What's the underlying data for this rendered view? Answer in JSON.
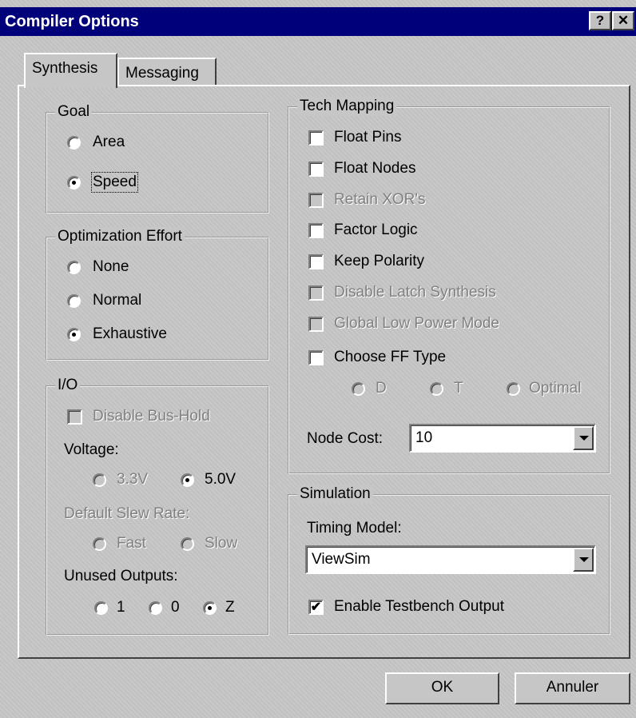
{
  "window": {
    "title": "Compiler Options",
    "help_label": "?",
    "close_label": "✕"
  },
  "tabs": [
    {
      "label": "Synthesis",
      "active": true
    },
    {
      "label": "Messaging",
      "active": false
    }
  ],
  "goal": {
    "legend": "Goal",
    "options": [
      {
        "label": "Area",
        "checked": false
      },
      {
        "label": "Speed",
        "checked": true
      }
    ]
  },
  "optimization": {
    "legend": "Optimization Effort",
    "options": [
      {
        "label": "None",
        "checked": false
      },
      {
        "label": "Normal",
        "checked": false
      },
      {
        "label": "Exhaustive",
        "checked": true
      }
    ]
  },
  "io": {
    "legend": "I/O",
    "disable_bus_hold": "Disable Bus-Hold",
    "voltage_label": "Voltage:",
    "voltage_options": [
      {
        "label": "3.3V",
        "checked": false
      },
      {
        "label": "5.0V",
        "checked": true
      }
    ],
    "slew_label": "Default Slew Rate:",
    "slew_options": [
      {
        "label": "Fast",
        "checked": false
      },
      {
        "label": "Slow",
        "checked": false
      }
    ],
    "unused_label": "Unused Outputs:",
    "unused_options": [
      {
        "label": "1",
        "checked": false
      },
      {
        "label": "0",
        "checked": false
      },
      {
        "label": "Z",
        "checked": true
      }
    ]
  },
  "tech_mapping": {
    "legend": "Tech Mapping",
    "checks": [
      {
        "label": "Float Pins",
        "checked": false,
        "enabled": true
      },
      {
        "label": "Float Nodes",
        "checked": false,
        "enabled": true
      },
      {
        "label": "Retain XOR's",
        "checked": false,
        "enabled": false
      },
      {
        "label": "Factor Logic",
        "checked": false,
        "enabled": true
      },
      {
        "label": "Keep Polarity",
        "checked": false,
        "enabled": true
      },
      {
        "label": "Disable Latch Synthesis",
        "checked": false,
        "enabled": false
      },
      {
        "label": "Global Low Power Mode",
        "checked": false,
        "enabled": false
      },
      {
        "label": "Choose FF Type",
        "checked": false,
        "enabled": true
      }
    ],
    "ff_options": [
      {
        "label": "D"
      },
      {
        "label": "T"
      },
      {
        "label": "Optimal"
      }
    ],
    "node_cost_label": "Node Cost:",
    "node_cost_value": "10"
  },
  "simulation": {
    "legend": "Simulation",
    "timing_label": "Timing Model:",
    "timing_value": "ViewSim",
    "testbench_label": "Enable Testbench Output",
    "testbench_checked": true
  },
  "buttons": {
    "ok": "OK",
    "cancel": "Annuler"
  }
}
